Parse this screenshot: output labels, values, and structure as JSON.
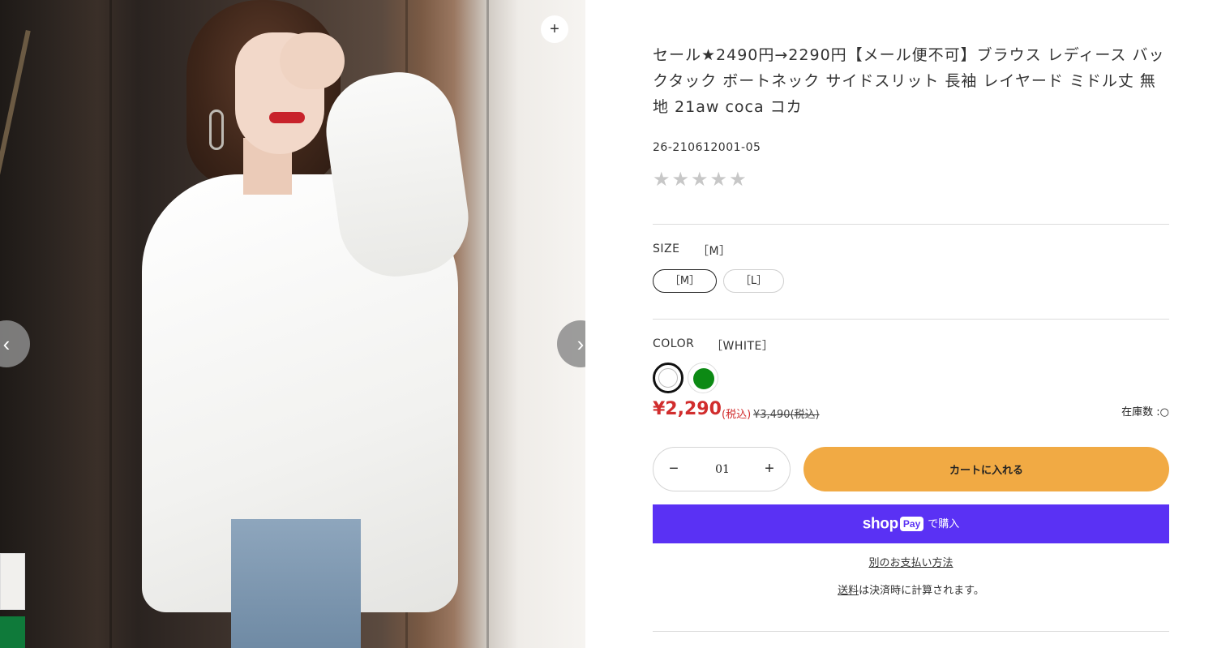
{
  "gallery": {
    "zoom_label": "+",
    "prev_label": "‹",
    "next_label": "›"
  },
  "product": {
    "title": "セール★2490円→2290円【メール便不可】ブラウス レディース バックタック ボートネック サイドスリット 長袖 レイヤード ミドル丈 無地 21aw coca コカ",
    "sku": "26-210612001-05",
    "stars": "★★★★★",
    "rating": 0
  },
  "size": {
    "label": "SIZE",
    "selected": "［M］",
    "options": [
      "［M］",
      "［L］"
    ]
  },
  "color": {
    "label": "COLOR",
    "selected": "［WHITE］",
    "options": [
      {
        "name": "WHITE",
        "hex": "#ffffff"
      },
      {
        "name": "GREEN",
        "hex": "#0c8a14"
      }
    ]
  },
  "price": {
    "sale": "¥2,290",
    "tax_note": "(税込)",
    "original": "¥3,490(税込)",
    "stock_label": "在庫数 :",
    "stock_symbol": "○",
    "sale_color": "#d12d2d"
  },
  "cart": {
    "minus": "−",
    "plus": "+",
    "quantity": "01",
    "add_to_cart": "カートに入れる",
    "add_to_cart_color": "#f1aa44"
  },
  "shoppay": {
    "shop": "shop",
    "pay": "Pay",
    "suffix": "で購入",
    "color": "#5a31f4"
  },
  "more_payment": "別のお支払い方法",
  "shipping": {
    "link": "送料",
    "text": "は決済時に計算されます。"
  }
}
